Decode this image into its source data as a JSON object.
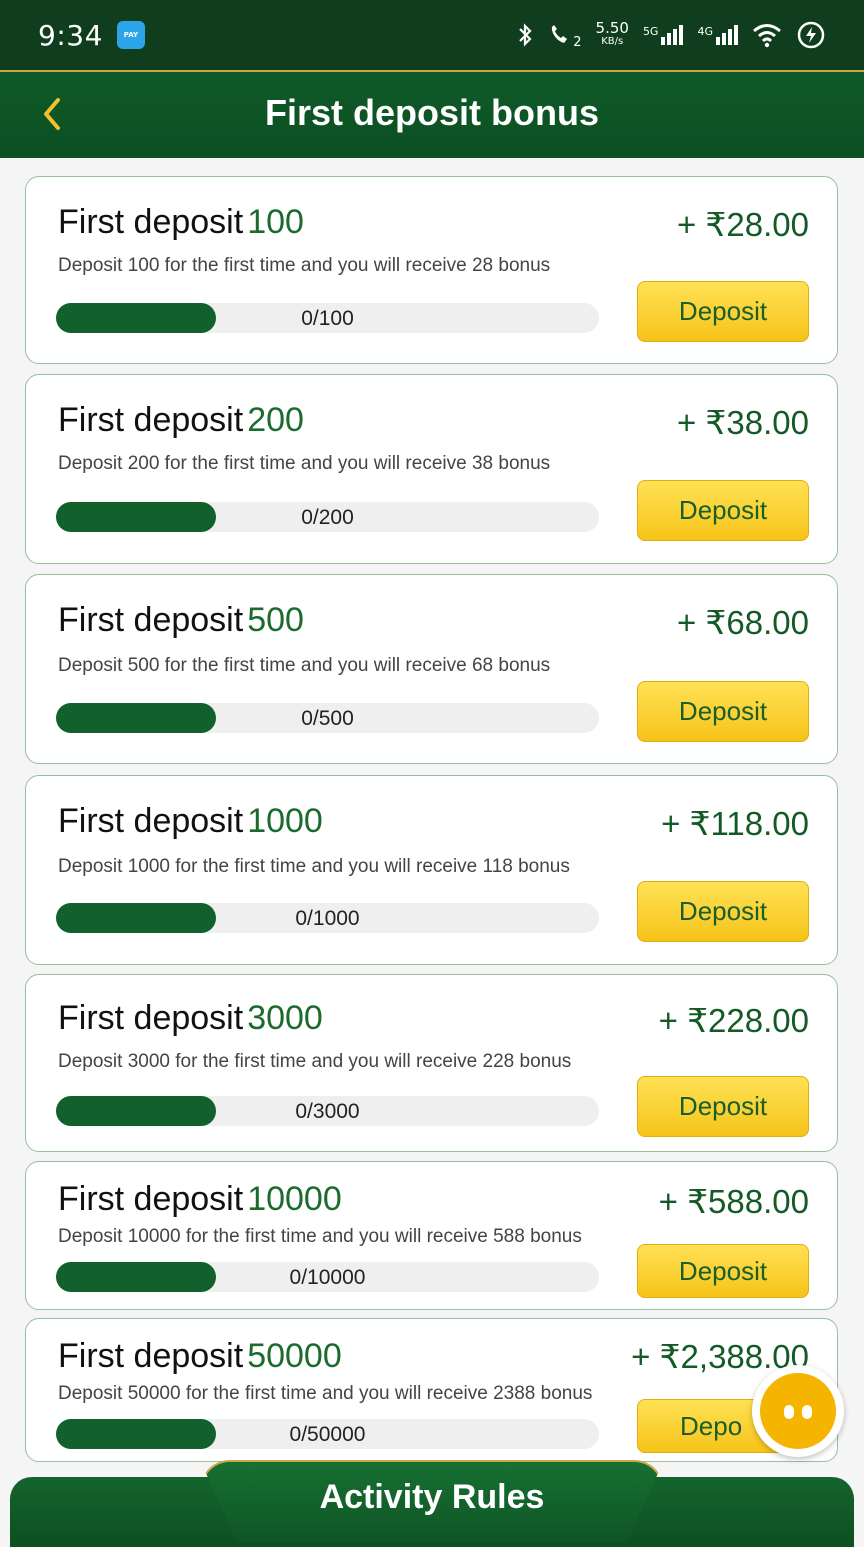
{
  "status_bar": {
    "time": "9:34",
    "app_icon": "paytm-icon",
    "speed_value": "5.50",
    "speed_unit": "KB/s",
    "net1": "5G",
    "net2": "4G",
    "sim": "2"
  },
  "header": {
    "title": "First deposit bonus",
    "back_icon": "chevron-left-icon",
    "accent": "#0f5a28"
  },
  "cards": [
    {
      "title": "First deposit",
      "amount": "100",
      "reward": "+ ₹28.00",
      "desc": "Deposit 100 for the first time and you will receive 28 bonus",
      "progress": "0/100",
      "button": "Deposit"
    },
    {
      "title": "First deposit",
      "amount": "200",
      "reward": "+ ₹38.00",
      "desc": "Deposit 200 for the first time and you will receive 38 bonus",
      "progress": "0/200",
      "button": "Deposit"
    },
    {
      "title": "First deposit",
      "amount": "500",
      "reward": "+ ₹68.00",
      "desc": "Deposit 500 for the first time and you will receive 68 bonus",
      "progress": "0/500",
      "button": "Deposit"
    },
    {
      "title": "First deposit",
      "amount": "1000",
      "reward": "+ ₹118.00",
      "desc": "Deposit 1000 for the first time and you will receive 118 bonus",
      "progress": "0/1000",
      "button": "Deposit"
    },
    {
      "title": "First deposit",
      "amount": "3000",
      "reward": "+ ₹228.00",
      "desc": "Deposit 3000 for the first time and you will receive 228 bonus",
      "progress": "0/3000",
      "button": "Deposit"
    },
    {
      "title": "First deposit",
      "amount": "10000",
      "reward": "+ ₹588.00",
      "desc": "Deposit 10000 for the first time and you will receive 588 bonus",
      "progress": "0/10000",
      "button": "Deposit"
    },
    {
      "title": "First deposit",
      "amount": "50000",
      "reward": "+ ₹2,388.00",
      "desc": "Deposit 50000 for the first time and you will receive 2388 bonus",
      "progress": "0/50000",
      "button": "Depo"
    }
  ],
  "footer": {
    "label": "Activity Rules"
  },
  "floating_button": {
    "icon": "chat-assistant-icon"
  }
}
